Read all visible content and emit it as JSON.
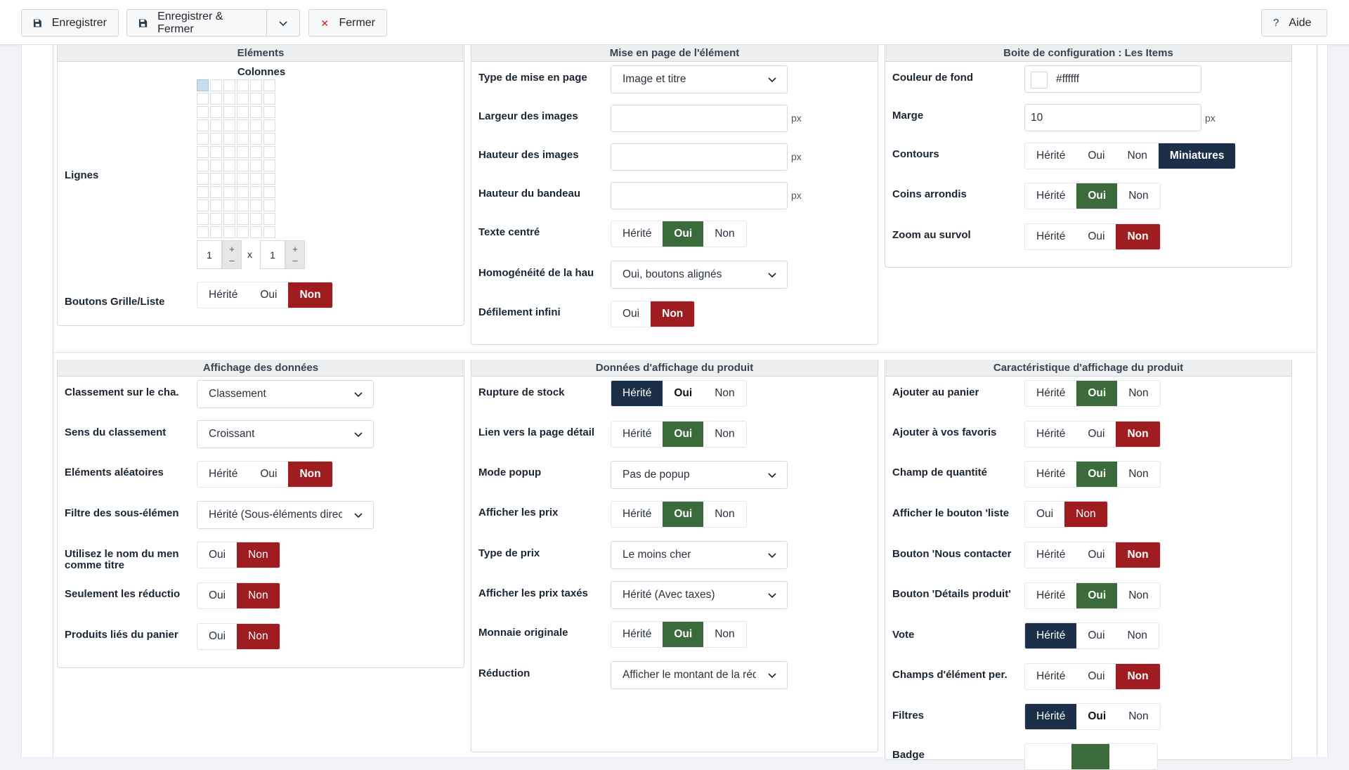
{
  "toolbar": {
    "save": "Enregistrer",
    "save_close": "Enregistrer & Fermer",
    "close": "Fermer",
    "help": "Aide"
  },
  "panels": {
    "elements": {
      "title": "Eléments",
      "columns_label": "Colonnes",
      "rows_label": "Lignes",
      "rows_value": "1",
      "times": "x",
      "cols_value": "1",
      "plus": "+",
      "minus": "–",
      "grid_buttons_label": "Boutons Grille/Liste",
      "grid_buttons": [
        "Hérité",
        "Oui",
        "Non"
      ]
    },
    "layout": {
      "title": "Mise en page de l'élément",
      "layout_type_label": "Type de mise en page",
      "layout_type_value": "Image et titre",
      "img_width_label": "Largeur des images",
      "img_height_label": "Hauteur des images",
      "banner_height_label": "Hauteur du bandeau",
      "unit": "px",
      "centered_label": "Texte centré",
      "centered": [
        "Hérité",
        "Oui",
        "Non"
      ],
      "homog_label": "Homogénéité de la hau",
      "homog_value": "Oui, boutons alignés",
      "infinite_label": "Défilement infini",
      "infinite": [
        "Oui",
        "Non"
      ]
    },
    "config": {
      "title": "Boite de configuration : Les Items",
      "bg_label": "Couleur de fond",
      "bg_value": "#ffffff",
      "margin_label": "Marge",
      "margin_value": "10",
      "unit": "px",
      "contours_label": "Contours",
      "contours": [
        "Hérité",
        "Oui",
        "Non",
        "Miniatures"
      ],
      "rounded_label": "Coins arrondis",
      "rounded": [
        "Hérité",
        "Oui",
        "Non"
      ],
      "zoom_label": "Zoom au survol",
      "zoom": [
        "Hérité",
        "Oui",
        "Non"
      ]
    },
    "data_display": {
      "title": "Affichage des données",
      "sort_field_label": "Classement sur le cha..",
      "sort_field_value": "Classement",
      "sort_dir_label": "Sens du classement",
      "sort_dir_value": "Croissant",
      "random_label": "Eléments aléatoires",
      "random": [
        "Hérité",
        "Oui",
        "Non"
      ],
      "sub_filter_label": "Filtre des sous-élémen",
      "sub_filter_value": "Hérité (Sous-éléments directs)",
      "menu_title_label_1": "Utilisez le nom du men",
      "menu_title_label_2": "comme titre",
      "menu_title": [
        "Oui",
        "Non"
      ],
      "discounts_label": "Seulement les réductio",
      "discounts": [
        "Oui",
        "Non"
      ],
      "cart_label": "Produits liés du panier",
      "cart": [
        "Oui",
        "Non"
      ]
    },
    "product_data": {
      "title": "Données d'affichage du produit",
      "stock_label": "Rupture de stock",
      "stock": [
        "Hérité",
        "Oui",
        "Non"
      ],
      "detail_link_label": "Lien vers la page détail",
      "detail_link": [
        "Hérité",
        "Oui",
        "Non"
      ],
      "popup_label": "Mode popup",
      "popup_value": "Pas de popup",
      "prices_label": "Afficher les prix",
      "prices": [
        "Hérité",
        "Oui",
        "Non"
      ],
      "price_type_label": "Type de prix",
      "price_type_value": "Le moins cher",
      "taxed_label": "Afficher les prix taxés",
      "taxed_value": "Hérité (Avec taxes)",
      "currency_label": "Monnaie originale",
      "currency": [
        "Hérité",
        "Oui",
        "Non"
      ],
      "reduction_label": "Réduction",
      "reduction_value": "Afficher le montant de la réduction"
    },
    "product_features": {
      "title": "Caractéristique d'affichage du produit",
      "add_cart_label": "Ajouter au panier",
      "add_cart": [
        "Hérité",
        "Oui",
        "Non"
      ],
      "add_fav_label": "Ajouter à vos favoris",
      "add_fav": [
        "Hérité",
        "Oui",
        "Non"
      ],
      "qty_label": "Champ de quantité",
      "qty": [
        "Hérité",
        "Oui",
        "Non"
      ],
      "list_btn_label": "Afficher le bouton 'liste",
      "list_btn": [
        "Oui",
        "Non"
      ],
      "contact_label": "Bouton 'Nous contacter",
      "contact": [
        "Hérité",
        "Oui",
        "Non"
      ],
      "details_label": "Bouton 'Détails produit'",
      "details": [
        "Hérité",
        "Oui",
        "Non"
      ],
      "vote_label": "Vote",
      "vote": [
        "Hérité",
        "Oui",
        "Non"
      ],
      "custom_label": "Champs d'élément per.",
      "custom": [
        "Hérité",
        "Oui",
        "Non"
      ],
      "filters_label": "Filtres",
      "filters": [
        "Hérité",
        "Oui",
        "Non"
      ],
      "badge_label": "Badge"
    }
  },
  "colors": {
    "active_blue": "#1c2f49",
    "active_green": "#3b6b3b",
    "active_red": "#9f1d20"
  }
}
